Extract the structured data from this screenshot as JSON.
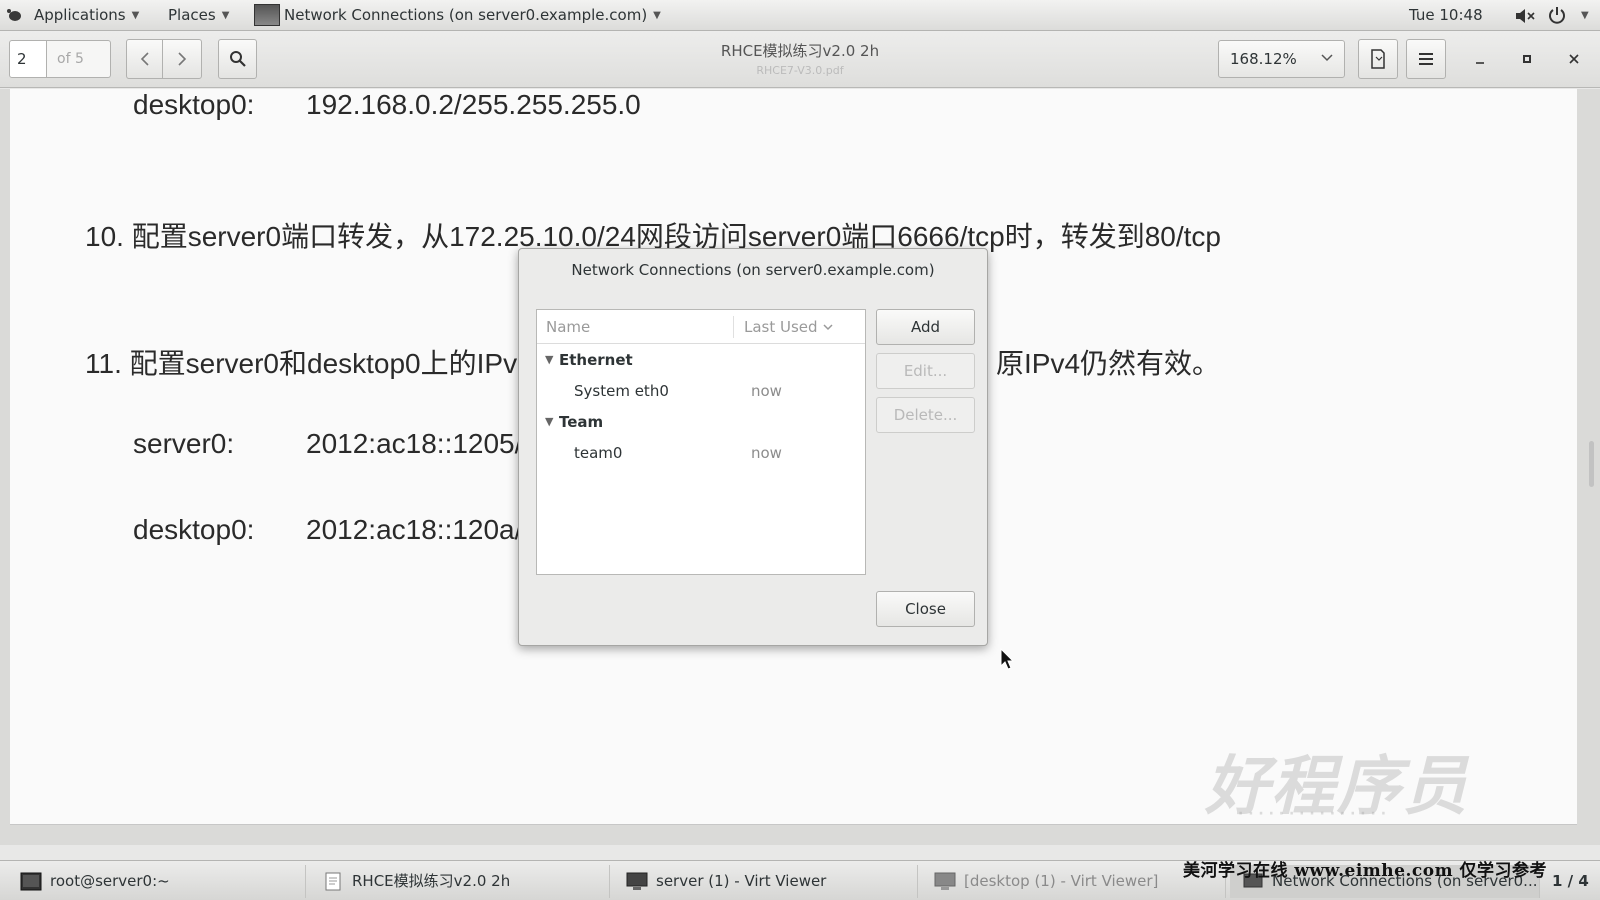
{
  "topbar": {
    "applications": "Applications",
    "places": "Places",
    "window": "Network Connections (on server0.example.com)",
    "clock": "Tue 10:48"
  },
  "toolbar": {
    "page_number": "2",
    "page_of": "of 5",
    "doc_title": "RHCE模拟练习v2.0 2h",
    "doc_file": "RHCE7-V3.0.pdf",
    "zoom": "168.12%"
  },
  "document": {
    "line1_host": "desktop0:",
    "line1_addr": "192.168.0.2/255.255.255.0",
    "item10": "10. 配置server0端口转发，从172.25.10.0/24网段访问server0端口6666/tcp时，转发到80/tcp",
    "item11_start": "11. 配置server0和desktop0上的IPv",
    "item11_end": "原IPv4仍然有效。",
    "server_host": "server0:",
    "server_addr": "2012:ac18::1205/",
    "desktop_host": "desktop0:",
    "desktop_addr": "2012:ac18::120a/"
  },
  "dialog": {
    "title": "Network Connections (on server0.example.com)",
    "col_name": "Name",
    "col_last_used": "Last Used",
    "groups": [
      {
        "name": "Ethernet",
        "connections": [
          {
            "name": "System eth0",
            "last_used": "now"
          }
        ]
      },
      {
        "name": "Team",
        "connections": [
          {
            "name": "team0",
            "last_used": "now"
          }
        ]
      }
    ],
    "add_label": "Add",
    "edit_label": "Edit...",
    "delete_label": "Delete...",
    "close_label": "Close"
  },
  "watermark": {
    "logo_text": "好程序员",
    "site_note": "美河学习在线 www.eimhe.com 仅学习参考"
  },
  "taskbar": {
    "tasks": [
      {
        "label": "root@server0:~"
      },
      {
        "label": "RHCE模拟练习v2.0 2h"
      },
      {
        "label": "server (1) - Virt Viewer"
      },
      {
        "label": "[desktop (1) - Virt Viewer]"
      },
      {
        "label": "Network Connections (on server0..."
      }
    ],
    "workspace": "1 / 4"
  }
}
